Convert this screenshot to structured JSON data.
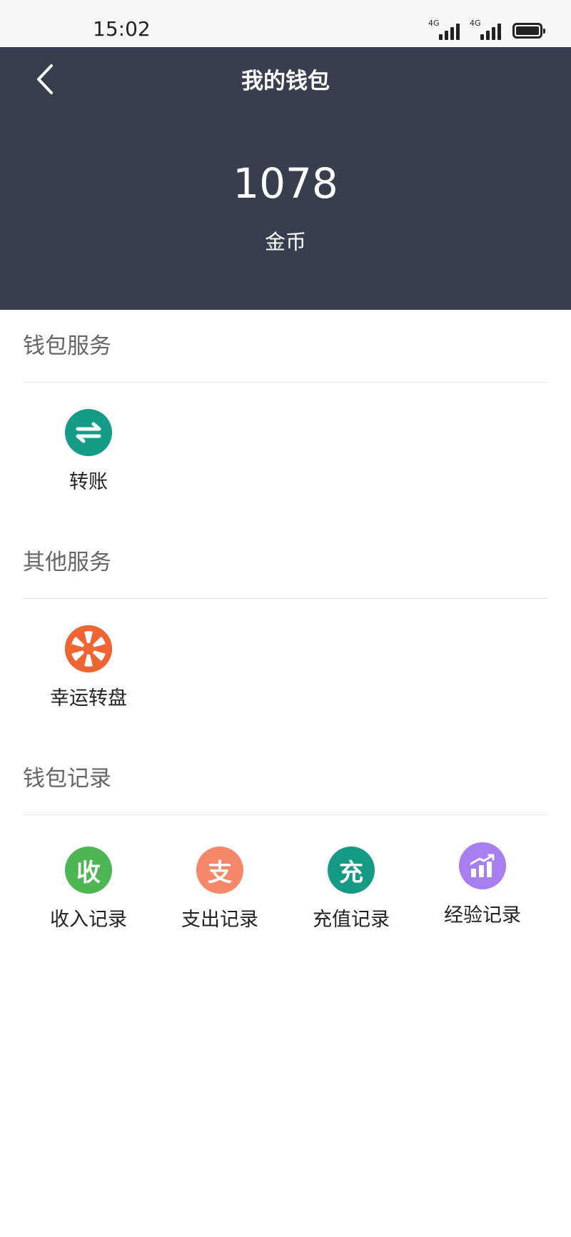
{
  "status_bar": {
    "time": "15:02",
    "network_1": "4G",
    "network_2": "4G"
  },
  "header": {
    "title": "我的钱包",
    "back_icon": "chevron-left-icon",
    "balance": "1078",
    "balance_unit": "金币",
    "background": "#383e4d"
  },
  "sections": {
    "wallet_service": {
      "title": "钱包服务",
      "items": [
        {
          "label": "转账",
          "icon": "transfer-icon",
          "color": "#169c86"
        }
      ]
    },
    "other_service": {
      "title": "其他服务",
      "items": [
        {
          "label": "幸运转盘",
          "icon": "lucky-wheel-icon",
          "color": "#ee6433"
        }
      ]
    },
    "wallet_records": {
      "title": "钱包记录",
      "items": [
        {
          "label": "收入记录",
          "glyph": "收",
          "icon": "income-icon",
          "color": "#4eb555"
        },
        {
          "label": "支出记录",
          "glyph": "支",
          "icon": "expense-icon",
          "color": "#f5876a"
        },
        {
          "label": "充值记录",
          "glyph": "充",
          "icon": "recharge-icon",
          "color": "#179a85"
        },
        {
          "label": "经验记录",
          "icon": "experience-chart-icon",
          "color": "#a87ff0"
        }
      ]
    }
  }
}
